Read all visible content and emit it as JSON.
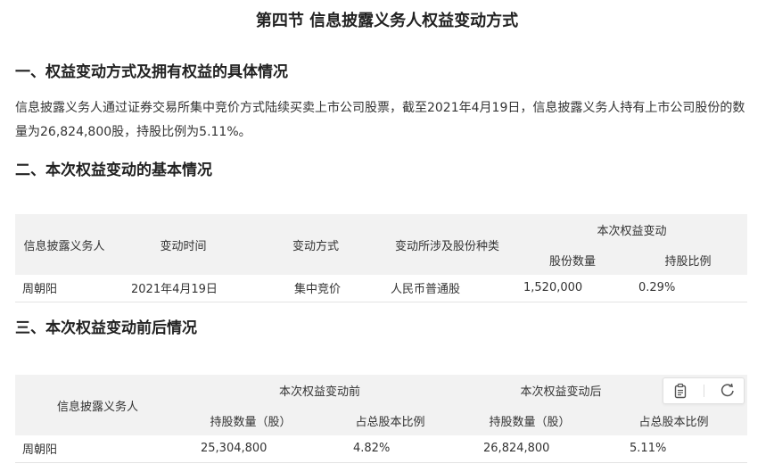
{
  "title": "第四节 信息披露义务人权益变动方式",
  "section1": {
    "heading": "一、权益变动方式及拥有权益的具体情况",
    "paragraph": "信息披露义务人通过证券交易所集中竞价方式陆续买卖上市公司股票，截至2021年4月19日，信息披露义务人持有上市公司股份的数量为26,824,800股，持股比例为5.11%。"
  },
  "section2": {
    "heading": "二、本次权益变动的基本情况",
    "table": {
      "headers": {
        "holder": "信息披露义务人",
        "time": "变动时间",
        "method": "变动方式",
        "class": "变动所涉及股份种类",
        "change_group": "本次权益变动",
        "shares": "股份数量",
        "ratio": "持股比例"
      },
      "rows": [
        {
          "holder": "周朝阳",
          "time": "2021年4月19日",
          "method": "集中竞价",
          "class": "人民币普通股",
          "shares": "1,520,000",
          "ratio": "0.29%"
        }
      ]
    }
  },
  "section3": {
    "heading": "三、本次权益变动前后情况",
    "table": {
      "headers": {
        "holder": "信息披露义务人",
        "before_group": "本次权益变动前",
        "after_group": "本次权益变动后",
        "before_shares": "持股数量（股）",
        "before_ratio": "占总股本比例",
        "after_shares": "持股数量（股）",
        "after_ratio": "占总股本比例"
      },
      "rows": [
        {
          "holder": "周朝阳",
          "before_shares": "25,304,800",
          "before_ratio": "4.82%",
          "after_shares": "26,824,800",
          "after_ratio": "5.11%"
        }
      ]
    }
  },
  "toolbar": {
    "copy_icon": "clipboard-icon",
    "refresh_icon": "refresh-icon"
  }
}
